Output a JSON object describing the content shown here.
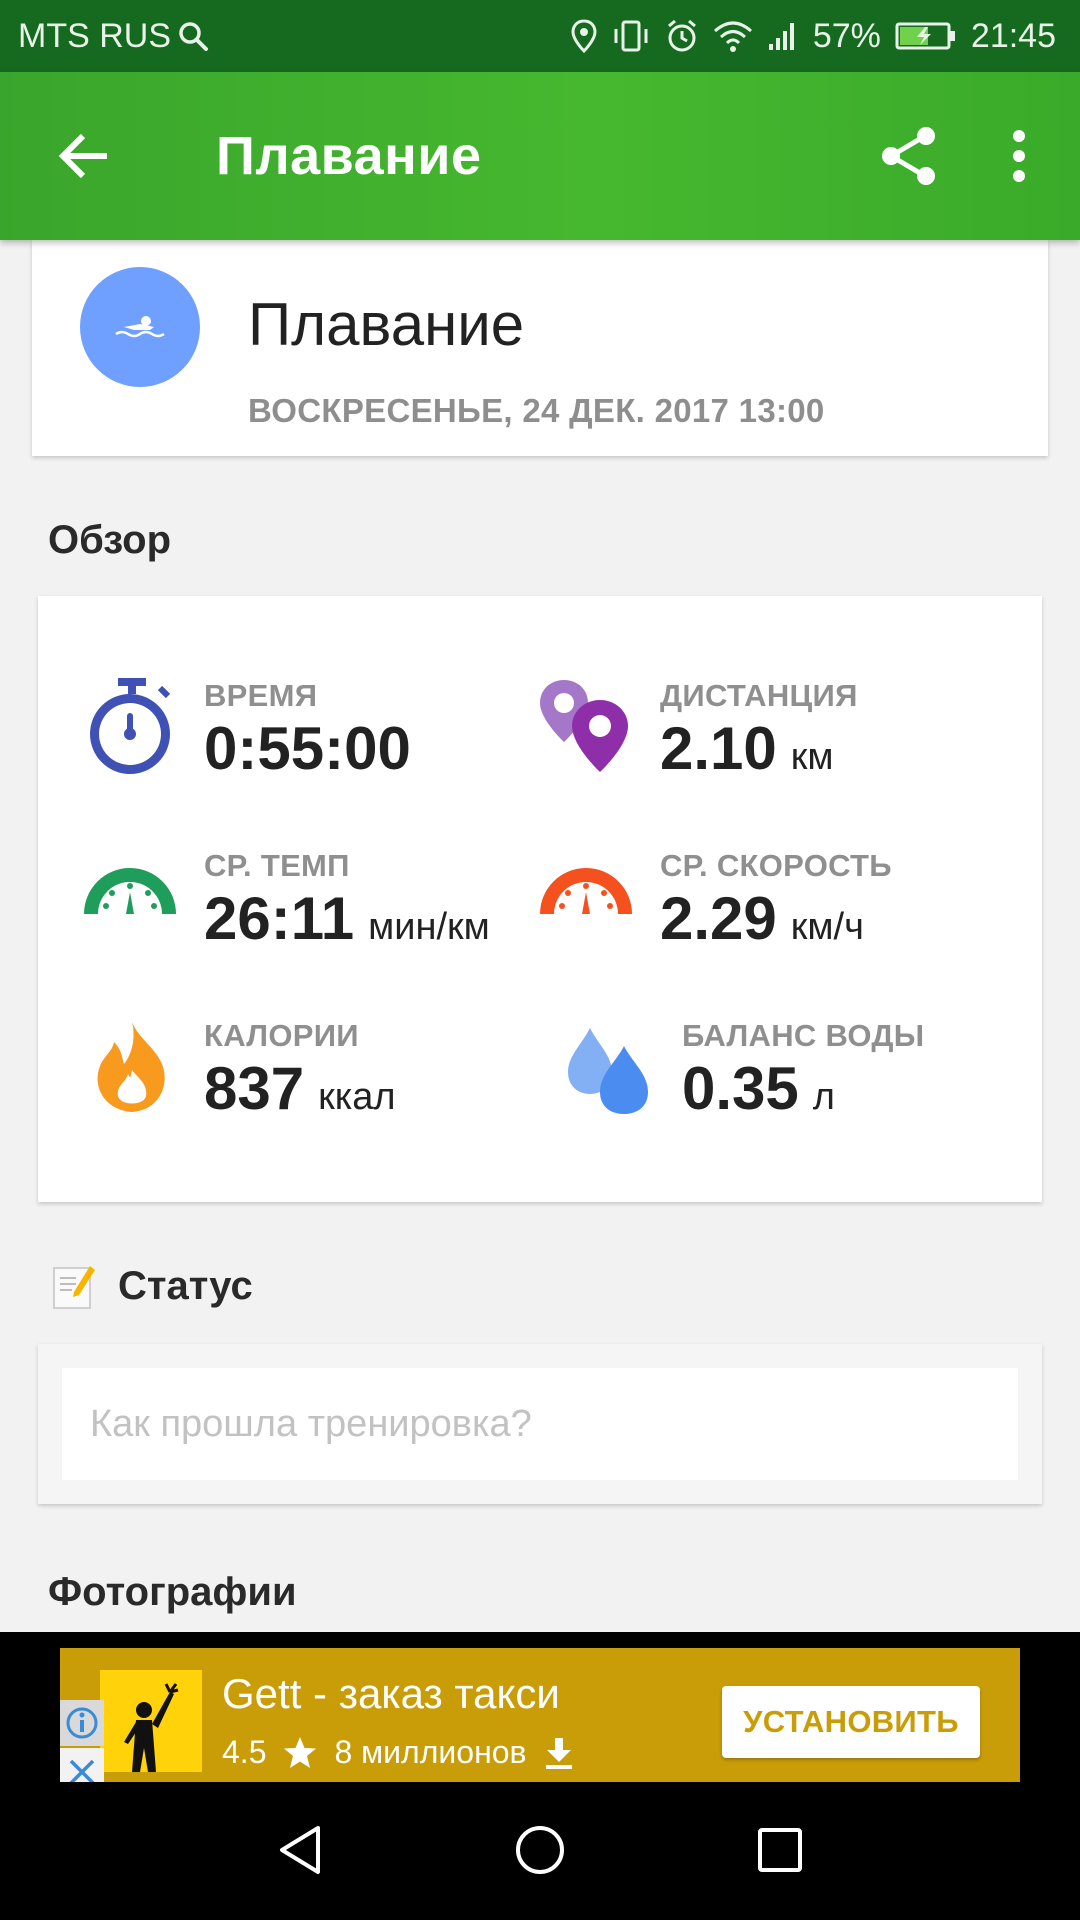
{
  "status_bar": {
    "carrier": "MTS RUS",
    "battery": "57%",
    "time": "21:45"
  },
  "app_bar": {
    "title": "Плавание"
  },
  "activity": {
    "name": "Плавание",
    "datetime": "ВОСКРЕСЕНЬЕ, 24 ДЕК. 2017 13:00"
  },
  "overview": {
    "section_title": "Обзор",
    "metrics": [
      {
        "label": "ВРЕМЯ",
        "value": "0:55:00",
        "unit": "",
        "icon": "stopwatch-icon",
        "color": "#3f51b5"
      },
      {
        "label": "ДИСТАНЦИЯ",
        "value": "2.10",
        "unit": "км",
        "icon": "map-pin-icon",
        "color": "#8e2ea8"
      },
      {
        "label": "СР. ТЕМП",
        "value": "26:11",
        "unit": "мин/км",
        "icon": "speedometer-icon",
        "color": "#1e9e5a"
      },
      {
        "label": "СР. СКОРОСТЬ",
        "value": "2.29",
        "unit": "км/ч",
        "icon": "speedometer-icon",
        "color": "#f4511e"
      },
      {
        "label": "КАЛОРИИ",
        "value": "837",
        "unit": "ккал",
        "icon": "flame-icon",
        "color": "#f79a1e"
      },
      {
        "label": "БАЛАНС ВОДЫ",
        "value": "0.35",
        "unit": "л",
        "icon": "water-drop-icon",
        "color": "#4a8cf0"
      }
    ]
  },
  "status": {
    "section_title": "Статус",
    "placeholder": "Как прошла тренировка?"
  },
  "photos": {
    "section_title": "Фотографии"
  },
  "ad": {
    "title": "Gett - заказ такси",
    "rating": "4.5",
    "installs": "8 миллионов",
    "button": "УСТАНОВИТЬ",
    "color": "#c99d08"
  }
}
